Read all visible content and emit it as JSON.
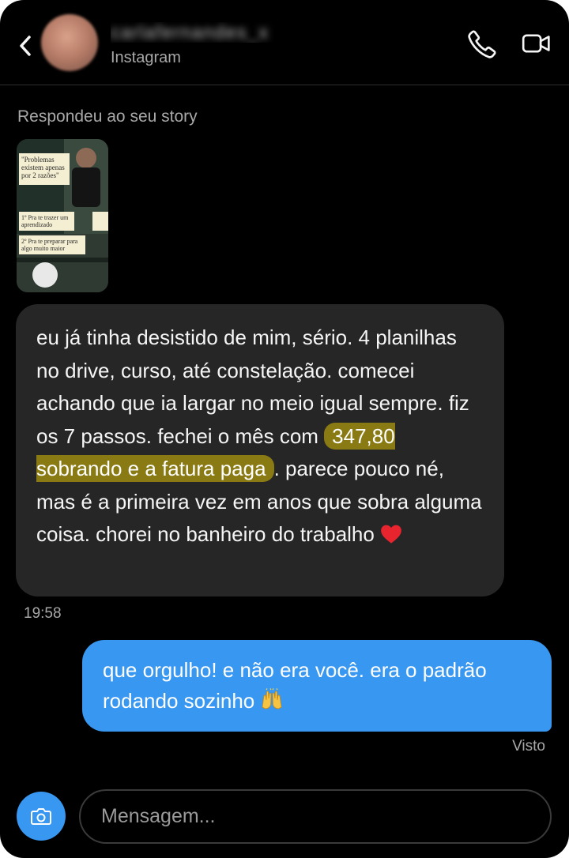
{
  "header": {
    "username": "carlafernandes_x",
    "subtitle": "Instagram",
    "back_icon": "chevron-left-icon",
    "call_icon": "phone-icon",
    "video_icon": "video-camera-icon"
  },
  "story_reply": {
    "label": "Respondeu ao seu story",
    "thumbnail": {
      "quote": "\"Problemas existem apenas por 2 razões\"",
      "point1": "1º Pra te trazer um aprendizado",
      "point2": "2º Pra te preparar para algo muito maior"
    }
  },
  "messages": {
    "incoming": {
      "text_before": "eu já tinha desistido de mim, sério. 4 planilhas no drive, curso, até constelação. comecei achando que ia largar no meio igual sempre. fiz os 7 passos. fechei o mês com ",
      "highlight": "347,80 sobrando e a fatura paga",
      "text_after": ". parece pouco né, mas é a primeira vez em anos que sobra alguma coisa. chorei no banheiro do trabalho ",
      "emoji": "heart-emoji",
      "time": "19:58"
    },
    "outgoing": {
      "text": "que orgulho! e não era você. era o padrão rodando sozinho ",
      "emoji": "raised-hands-emoji",
      "status": "Visto"
    }
  },
  "composer": {
    "placeholder": "Mensagem...",
    "camera_icon": "camera-icon"
  },
  "colors": {
    "background": "#000000",
    "incoming_bubble": "#262626",
    "outgoing_bubble": "#3897f0",
    "highlight": "#8a7a14",
    "muted_text": "#a8a8a8"
  }
}
